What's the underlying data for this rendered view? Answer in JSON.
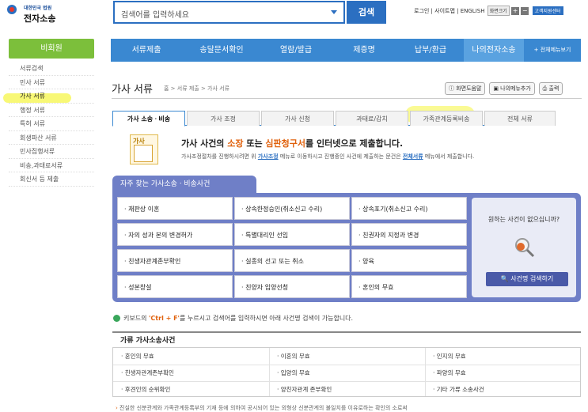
{
  "header": {
    "logo_small": "대한민국 법원",
    "logo_big": "전자소송",
    "search_placeholder": "검색어를 입력하세요",
    "search_button": "검색",
    "links": {
      "login": "로그인",
      "sitemap": "사이트맵",
      "english": "ENGLISH",
      "screen_size": "화면크기",
      "plus": "+",
      "minus": "−",
      "support": "고객지원센터"
    }
  },
  "sidebar": {
    "title": "비회원",
    "items": [
      {
        "label": "서류검색"
      },
      {
        "label": "민사 서류"
      },
      {
        "label": "가사 서류"
      },
      {
        "label": "행정 서류"
      },
      {
        "label": "특허 서류"
      },
      {
        "label": "회생파산 서류"
      },
      {
        "label": "민사집행서류"
      },
      {
        "label": "비송,과태료서류"
      },
      {
        "label": "회신서 등 제출"
      }
    ]
  },
  "nav": {
    "items": [
      "서류제출",
      "송달문서확인",
      "열람/발급",
      "제증명",
      "납부/환급",
      "나의전자소송",
      "전체메뉴보기"
    ],
    "all_prefix": "+"
  },
  "page": {
    "title": "가사 서류",
    "breadcrumb": "홈 > 서류 제출 > 가사 서류",
    "tools": [
      "화면도움말",
      "나의메뉴추가",
      "출력"
    ]
  },
  "tabs": [
    "가사 소송ㆍ비송",
    "가사 조정",
    "가사 신청",
    "과태료/감치",
    "가족관계등록비송",
    "전체 서류"
  ],
  "intro": {
    "icon_label": "가사",
    "title_pre": "가사 사건의 ",
    "title_h1": "소장",
    "title_mid": " 또는 ",
    "title_h2": "심판청구서",
    "title_post": "를 인터넷으로 제출합니다.",
    "sub_pre": "가사조정절차를 진행하시려면 위 ",
    "sub_link1": "가사조정",
    "sub_mid": " 메뉴로 이동하시고 진행중인 사건에 제출하는 문건은 ",
    "sub_link2": "전체서류",
    "sub_post": " 메뉴에서 제출합니다."
  },
  "frequent": {
    "title": "자주 찾는 가사소송ㆍ비송사건",
    "cells": [
      "· 재판상 이혼",
      "· 상속한정승인(취소신고 수리)",
      "· 상속포기(취소신고 수리)",
      "· 자의 성과 본의 변경허가",
      "· 특별대리인 선임",
      "· 친권자의 지정과 변경",
      "· 친생자관계존부확인",
      "· 실종의 선고 또는 취소",
      "· 양육",
      "· 성본창설",
      "· 친양자 입양선청",
      "· 혼인의 무효"
    ],
    "question": "원하는 사건이 없으십니까?",
    "search_button": "사건명 검색하기"
  },
  "tip": {
    "pre": "키보드의 ",
    "key": "'Ctrl + F'",
    "post": "를 누르시고 검색어를 입력하시면 아래 사건명 검색이 가능합니다."
  },
  "lower": {
    "title": "가류 가사소송사건",
    "cells": [
      "· 혼인의 무효",
      "· 이혼의 무효",
      "· 인지의 무효",
      "· 친생자관계존부확인",
      "· 입양의 무효",
      "· 파양의 무효",
      "· 후견인의 순위확인",
      "· 양친자관계 존부확인",
      "· 기타 가류 소송사건"
    ]
  },
  "footer_note": "진실한 신분관계와 가족관계등록부의 기재 등에 의하여 공시되어 있는 외형상 신분관계의 불일치를 이유로하는 확인의 소로써"
}
